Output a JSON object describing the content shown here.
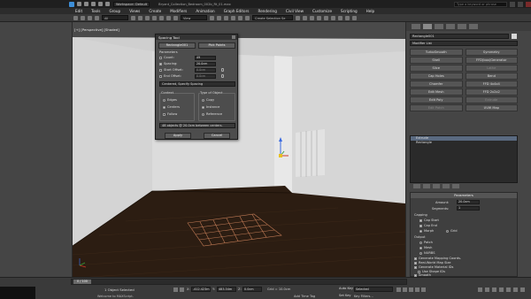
{
  "titlebar": {
    "workspace": "Workspace: Default",
    "filename": "Bryant_Collection_Bedroom_002b_Rt_01.max",
    "search_placeholder": "Type a keyword or phrase"
  },
  "menu": [
    "Edit",
    "Tools",
    "Group",
    "Views",
    "Create",
    "Modifiers",
    "Animation",
    "Graph Editors",
    "Rendering",
    "Civil View",
    "Customize",
    "Scripting",
    "Help"
  ],
  "toolbar": {
    "filter": "All",
    "view": "View",
    "selection_set": "Create Selection Se"
  },
  "viewport": {
    "label": "[+] [Perspective] [Shaded]"
  },
  "spacing_dialog": {
    "title": "Spacing Tool",
    "pick_path": "Rectangle001",
    "pick_points": "Pick Points",
    "parameters_label": "Parameters",
    "count_label": "Count:",
    "count_value": "49",
    "spacing_label": "Spacing:",
    "spacing_value": "20.0cm",
    "start_offset_label": "Start Offset:",
    "start_offset_value": "0.0cm",
    "end_offset_label": "End Offset:",
    "end_offset_value": "0.0cm",
    "distribution": "Centered, Specify Spacing",
    "context_label": "Context",
    "edges": "Edges",
    "centers": "Centers",
    "follow": "Follow",
    "type_label": "Type of Object",
    "copy": "Copy",
    "instance": "Instance",
    "reference": "Reference",
    "status": "48 objects @ 20.0cm between centers.",
    "apply": "Apply",
    "cancel": "Cancel"
  },
  "command_panel": {
    "object_name": "Rectangle001",
    "modifier_list": "Modifier List",
    "modifier_buttons": [
      "TurboSmooth",
      "Symmetry",
      "Shell",
      "FFD(box)Generator",
      "Slice",
      "Lathe",
      "Cap Holes",
      "Bend",
      "Chamfer",
      "FFD 4x4x4",
      "Edit Mesh",
      "FFD 2x2x2",
      "Edit Poly",
      "Extrude",
      "Edit Patch",
      "UVW Map"
    ],
    "stack": [
      "Extrude",
      "Rectangle"
    ],
    "parameters_title": "Parameters",
    "amount_label": "Amount:",
    "amount_value": "20.0cm",
    "segments_label": "Segments:",
    "segments_value": "1",
    "capping_label": "Capping",
    "cap_start": "Cap Start",
    "cap_end": "Cap End",
    "morph": "Morph",
    "grid": "Grid",
    "output_label": "Output",
    "patch": "Patch",
    "mesh": "Mesh",
    "nurbs": "NURBS",
    "gen_mapping": "Generate Mapping Coords.",
    "real_world": "Real-World Map Size",
    "gen_material": "Generate Material IDs",
    "use_shape_ids": "Use Shape IDs",
    "smooth": "Smooth"
  },
  "status_bar": {
    "time_slider": "0 / 100",
    "selection": "1 Object Selected",
    "prompt": "Welcome to MAXScript.",
    "x_label": "X:",
    "x_value": "-412.423m",
    "y_label": "Y:",
    "y_value": "483.34m",
    "z_label": "Z:",
    "z_value": "0.0cm",
    "grid": "Grid = 10.0cm",
    "auto_key": "Auto Key",
    "set_key": "Set Key",
    "selected": "Selected",
    "key_filters": "Key Filters...",
    "add_time_tag": "Add Time Tag"
  },
  "colors": {
    "wall": "#d8d8d8",
    "floor": "#2a1c12",
    "grid": "#c07a55"
  }
}
